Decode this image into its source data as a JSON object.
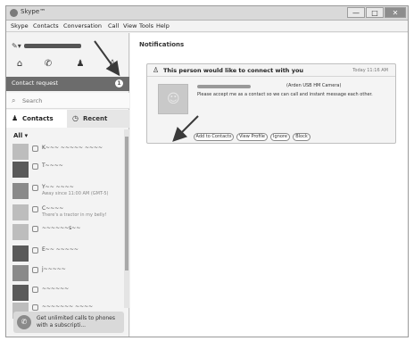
{
  "window": {
    "title": "Skype™",
    "minimize": "—",
    "maximize": "□",
    "close": "✕"
  },
  "menu": [
    "Skype",
    "Contacts",
    "Conversation",
    "Call",
    "View",
    "Tools",
    "Help"
  ],
  "sidebar": {
    "contact_request_label": "Contact request",
    "contact_request_badge": "1",
    "search_placeholder": "Search",
    "tabs": {
      "contacts": "Contacts",
      "recent": "Recent"
    },
    "filter_label": "All ▾",
    "contacts": [
      {
        "name": "K~~~ ~~~~~ ~~~~",
        "sub": ""
      },
      {
        "name": "T~~~~",
        "sub": ""
      },
      {
        "name": "Y~~ ~~~~",
        "sub": "Away since 11:00 AM (GMT-5)"
      },
      {
        "name": "C~~~~",
        "sub": "There's a tractor in my belly!"
      },
      {
        "name": "~~~~~~s~~",
        "sub": ""
      },
      {
        "name": "E~~ ~~~~~",
        "sub": ""
      },
      {
        "name": "j~~~~~",
        "sub": ""
      },
      {
        "name": "~~~~~~",
        "sub": ""
      },
      {
        "name": "~~~~~~~ ~~~~",
        "sub": ""
      }
    ],
    "promo": "Get unlimited calls to phones with a subscripti..."
  },
  "main": {
    "section_title": "Notifications",
    "card": {
      "title": "This person would like to connect with you",
      "time": "Today 11:16 AM",
      "location": "(Arden USB HM Camera)",
      "message": "Please accept me as a contact so we can call and instant message each other.",
      "buttons": {
        "add": "Add to Contacts",
        "profile": "View Profile",
        "ignore": "Ignore",
        "block": "Block"
      }
    }
  }
}
